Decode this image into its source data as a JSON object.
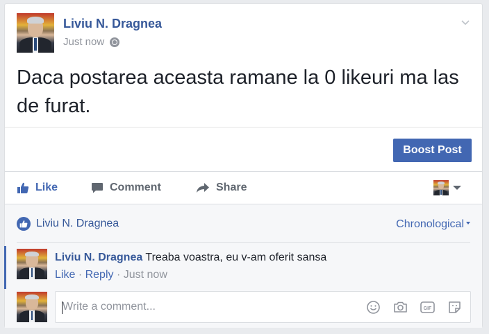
{
  "post": {
    "author": "Liviu N. Dragnea",
    "time": "Just now",
    "privacy_icon": "globe-icon",
    "text": "Daca postarea aceasta ramane la 0 likeuri ma las de furat."
  },
  "boost_label": "Boost Post",
  "actions": {
    "like": "Like",
    "comment": "Comment",
    "share": "Share"
  },
  "likes": {
    "name": "Liviu N. Dragnea",
    "sort_label": "Chronological"
  },
  "comment": {
    "author": "Liviu N. Dragnea",
    "text": "Treaba voastra, eu v-am oferit sansa",
    "like_label": "Like",
    "dot": "·",
    "reply_label": "Reply",
    "time": "Just now"
  },
  "write_comment": {
    "placeholder": "Write a comment..."
  },
  "colors": {
    "accent": "#4267b2",
    "link": "#365899",
    "muted": "#90949c"
  }
}
